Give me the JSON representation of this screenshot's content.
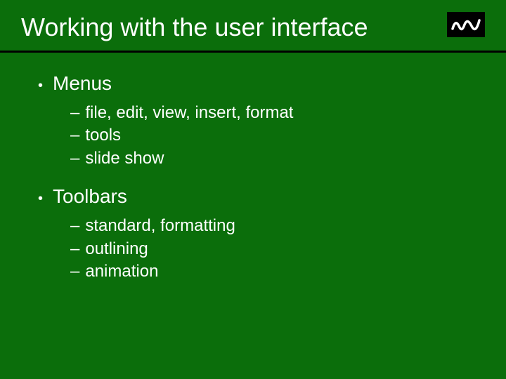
{
  "title": "Working with the user interface",
  "bullets": [
    {
      "label": "Menus",
      "subs": [
        "file, edit, view, insert, format",
        "tools",
        "slide show"
      ]
    },
    {
      "label": "Toolbars",
      "subs": [
        "standard, formatting",
        "outlining",
        "animation"
      ]
    }
  ]
}
